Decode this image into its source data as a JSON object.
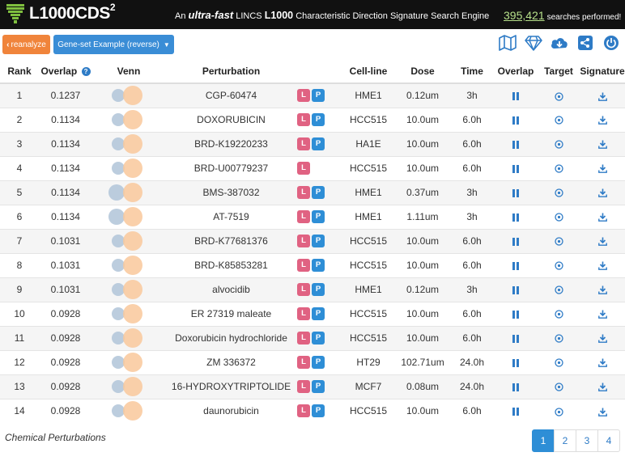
{
  "header": {
    "logo_text": "L1000CDS",
    "logo_sup": "2",
    "tagline_an": "An",
    "tagline_fast": "ultra-fast",
    "tagline_lincs": "LINCS",
    "tagline_l1000": "L1000",
    "tagline_rest": "Characteristic Direction Signature Search Engine",
    "counter_value": "395,421",
    "counter_text": "searches performed!"
  },
  "toolbar": {
    "reanalyze_label": "reanalyze",
    "geneset_label": "Gene-set Example (reverse)"
  },
  "icons": {
    "map": "map-icon",
    "diamond": "diamond-icon",
    "cloud": "cloud-download-icon",
    "share": "share-icon",
    "power": "power-icon"
  },
  "table": {
    "headers": {
      "rank": "Rank",
      "overlap": "Overlap",
      "venn": "Venn",
      "perturbation": "Perturbation",
      "cell_line": "Cell-line",
      "dose": "Dose",
      "time": "Time",
      "overlap2": "Overlap",
      "target": "Target",
      "signature": "Signature"
    },
    "rows": [
      {
        "rank": "1",
        "overlap": "0.1237",
        "perturbation": "CGP-60474",
        "cell_line": "HME1",
        "dose": "0.12um",
        "time": "3h",
        "l": "L",
        "p": "P"
      },
      {
        "rank": "2",
        "overlap": "0.1134",
        "perturbation": "DOXORUBICIN",
        "cell_line": "HCC515",
        "dose": "10.0um",
        "time": "6.0h",
        "l": "L",
        "p": "P"
      },
      {
        "rank": "3",
        "overlap": "0.1134",
        "perturbation": "BRD-K19220233",
        "cell_line": "HA1E",
        "dose": "10.0um",
        "time": "6.0h",
        "l": "L",
        "p": "P"
      },
      {
        "rank": "4",
        "overlap": "0.1134",
        "perturbation": "BRD-U00779237",
        "cell_line": "HCC515",
        "dose": "10.0um",
        "time": "6.0h",
        "l": "L",
        "p": ""
      },
      {
        "rank": "5",
        "overlap": "0.1134",
        "perturbation": "BMS-387032",
        "cell_line": "HME1",
        "dose": "0.37um",
        "time": "3h",
        "l": "L",
        "p": "P"
      },
      {
        "rank": "6",
        "overlap": "0.1134",
        "perturbation": "AT-7519",
        "cell_line": "HME1",
        "dose": "1.11um",
        "time": "3h",
        "l": "L",
        "p": "P"
      },
      {
        "rank": "7",
        "overlap": "0.1031",
        "perturbation": "BRD-K77681376",
        "cell_line": "HCC515",
        "dose": "10.0um",
        "time": "6.0h",
        "l": "L",
        "p": "P"
      },
      {
        "rank": "8",
        "overlap": "0.1031",
        "perturbation": "BRD-K85853281",
        "cell_line": "HCC515",
        "dose": "10.0um",
        "time": "6.0h",
        "l": "L",
        "p": "P"
      },
      {
        "rank": "9",
        "overlap": "0.1031",
        "perturbation": "alvocidib",
        "cell_line": "HME1",
        "dose": "0.12um",
        "time": "3h",
        "l": "L",
        "p": "P"
      },
      {
        "rank": "10",
        "overlap": "0.0928",
        "perturbation": "ER 27319 maleate",
        "cell_line": "HCC515",
        "dose": "10.0um",
        "time": "6.0h",
        "l": "L",
        "p": "P"
      },
      {
        "rank": "11",
        "overlap": "0.0928",
        "perturbation": "Doxorubicin hydrochloride",
        "cell_line": "HCC515",
        "dose": "10.0um",
        "time": "6.0h",
        "l": "L",
        "p": "P"
      },
      {
        "rank": "12",
        "overlap": "0.0928",
        "perturbation": "ZM 336372",
        "cell_line": "HT29",
        "dose": "102.71um",
        "time": "24.0h",
        "l": "L",
        "p": "P"
      },
      {
        "rank": "13",
        "overlap": "0.0928",
        "perturbation": "16-HYDROXYTRIPTOLIDE",
        "cell_line": "MCF7",
        "dose": "0.08um",
        "time": "24.0h",
        "l": "L",
        "p": "P"
      },
      {
        "rank": "14",
        "overlap": "0.0928",
        "perturbation": "daunorubicin",
        "cell_line": "HCC515",
        "dose": "10.0um",
        "time": "6.0h",
        "l": "L",
        "p": "P"
      }
    ]
  },
  "footer": {
    "label": "Chemical Perturbations",
    "pages": [
      "1",
      "2",
      "3",
      "4"
    ],
    "active_page": "1"
  },
  "colors": {
    "reanalyze": "#f0843b",
    "primary": "#2e8ed6",
    "badge_l": "#e06282",
    "counter": "#b6e08a"
  }
}
